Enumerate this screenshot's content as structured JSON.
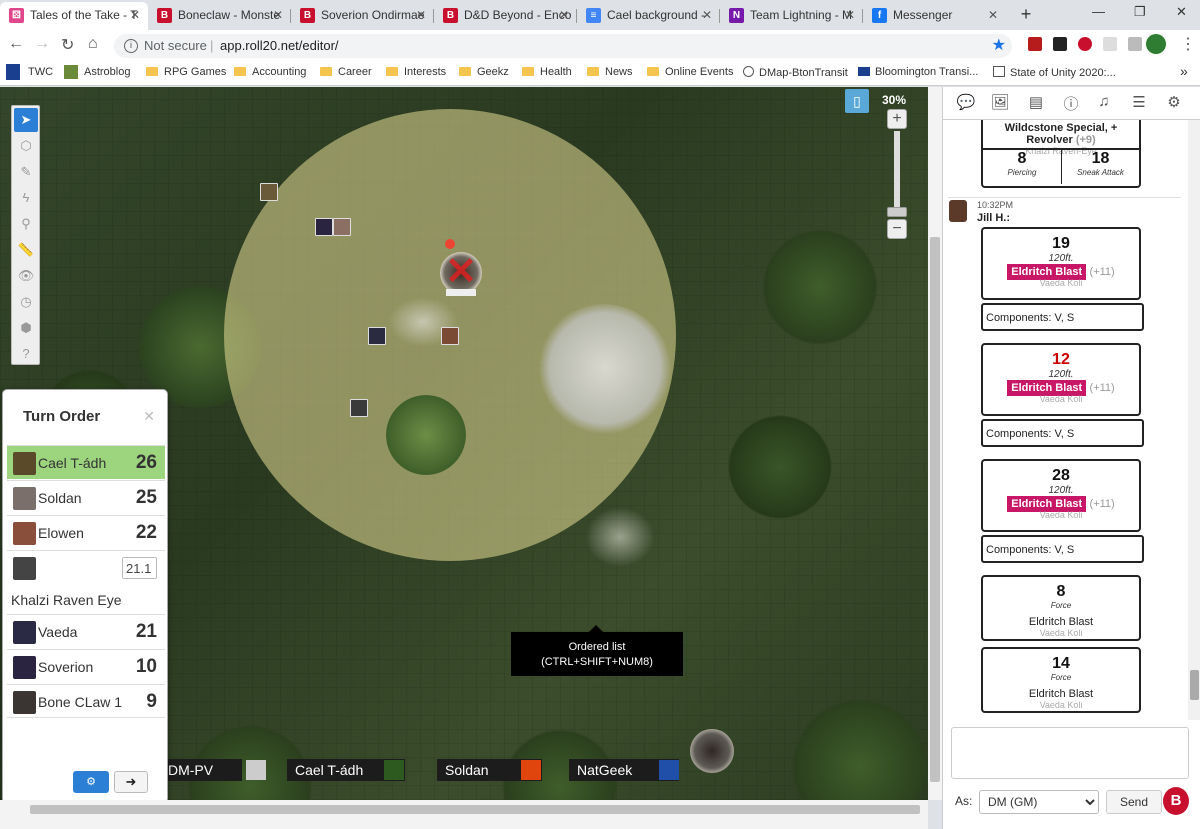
{
  "browser": {
    "tabs": [
      {
        "label": "Tales of the Take - T",
        "color": "#e0468a",
        "glyph": "⚄"
      },
      {
        "label": "Boneclaw - Monste",
        "color": "#c8102e",
        "glyph": "B"
      },
      {
        "label": "Soverion Ondirmae",
        "color": "#c8102e",
        "glyph": "B"
      },
      {
        "label": "D&D Beyond - Enco",
        "color": "#c8102e",
        "glyph": "B"
      },
      {
        "label": "Cael background - ",
        "color": "#4285f4",
        "glyph": "≡"
      },
      {
        "label": "Team Lightning - M",
        "color": "#7719aa",
        "glyph": "N"
      },
      {
        "label": "Messenger",
        "color": "#1877f2",
        "glyph": "f"
      }
    ],
    "security_label": "Not secure",
    "url": "app.roll20.net/editor/",
    "bookmarks": [
      {
        "label": "TWC"
      },
      {
        "label": "Astroblog"
      },
      {
        "label": "RPG Games"
      },
      {
        "label": "Accounting"
      },
      {
        "label": "Career"
      },
      {
        "label": "Interests"
      },
      {
        "label": "Geekz"
      },
      {
        "label": "Health"
      },
      {
        "label": "News"
      },
      {
        "label": "Online Events"
      },
      {
        "label": "DMap-BtonTransit"
      },
      {
        "label": "Bloomington Transi..."
      },
      {
        "label": "State of Unity 2020:..."
      }
    ]
  },
  "map": {
    "zoom": "30%",
    "tooltip_line1": "Ordered list",
    "tooltip_line2": "(CTRL+SHIFT+NUM8)",
    "players": [
      {
        "name": "DM-PV",
        "color": "#cccccc"
      },
      {
        "name": "Cael T-ádh",
        "color": "#2d5a1e"
      },
      {
        "name": "Soldan",
        "color": "#e0450e"
      },
      {
        "name": "NatGeek",
        "color": "#1f4fa8"
      }
    ]
  },
  "turn_order": {
    "title": "Turn Order",
    "entries": [
      {
        "name": "Cael T-ádh",
        "initiative": "26"
      },
      {
        "name": "Soldan",
        "initiative": "25"
      },
      {
        "name": "Elowen",
        "initiative": "22"
      },
      {
        "name": "Khalzi Raven Eye",
        "initiative": "21.1"
      },
      {
        "name": "Vaeda",
        "initiative": "21"
      },
      {
        "name": "Soverion",
        "initiative": "10"
      },
      {
        "name": "Bone CLaw 1",
        "initiative": "9"
      }
    ]
  },
  "chat": {
    "prev_card": {
      "title_top": "Wildcstone Special, +",
      "title": "Revolver",
      "bonus": "(+9)",
      "who": "Khalzi Raven-Eye",
      "damage1": "8",
      "damage1_type": "Piercing",
      "damage2": "18",
      "damage2_type": "Sneak Attack"
    },
    "message_time": "10:32PM",
    "message_author": "Jill H.:",
    "rolls": [
      {
        "value": "19",
        "range": "120ft.",
        "spell": "Eldritch Blast",
        "bonus": "(+11)",
        "who": "Vaeda Koli",
        "components": "Components: V, S"
      },
      {
        "value": "12",
        "range": "120ft.",
        "spell": "Eldritch Blast",
        "bonus": "(+11)",
        "who": "Vaeda Koli",
        "components": "Components: V, S"
      },
      {
        "value": "28",
        "range": "120ft.",
        "spell": "Eldritch Blast",
        "bonus": "(+11)",
        "who": "Vaeda Koli",
        "components": "Components: V, S"
      }
    ],
    "damage_rolls": [
      {
        "value": "8",
        "type": "Force",
        "spell": "Eldritch Blast",
        "who": "Vaeda Koli"
      },
      {
        "value": "14",
        "type": "Force",
        "spell": "Eldritch Blast",
        "who": "Vaeda Koli"
      }
    ],
    "as_label": "As:",
    "as_value": "DM (GM)",
    "send_label": "Send",
    "colors": {
      "spell_badge": "#c91768",
      "fail_roll": "#c00000"
    }
  }
}
